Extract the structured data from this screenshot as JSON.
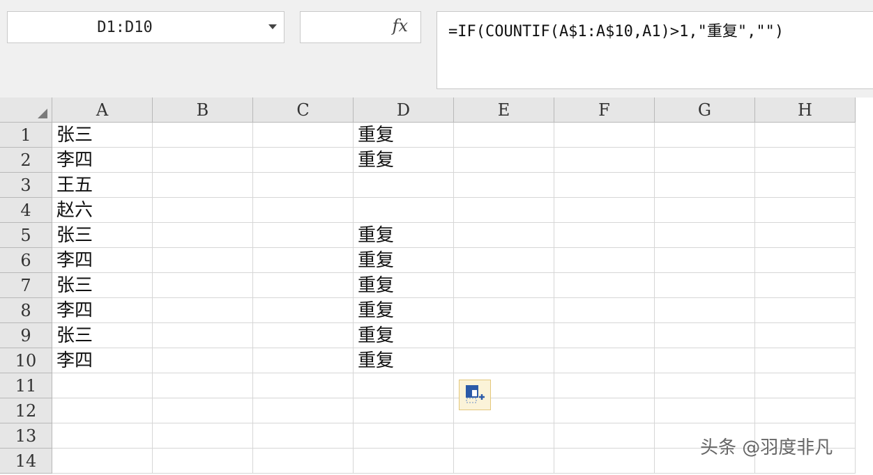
{
  "name_box": {
    "value": "D1:D10"
  },
  "formula_bar": {
    "fx_label": "fx",
    "formula": "=IF(COUNTIF(A$1:A$10,A1)>1,\"重复\",\"\")"
  },
  "columns": [
    "A",
    "B",
    "C",
    "D",
    "E",
    "F",
    "G",
    "H"
  ],
  "rows": [
    {
      "num": "1",
      "A": "张三",
      "D": "重复"
    },
    {
      "num": "2",
      "A": "李四",
      "D": "重复"
    },
    {
      "num": "3",
      "A": "王五",
      "D": ""
    },
    {
      "num": "4",
      "A": "赵六",
      "D": ""
    },
    {
      "num": "5",
      "A": "张三",
      "D": "重复"
    },
    {
      "num": "6",
      "A": "李四",
      "D": "重复"
    },
    {
      "num": "7",
      "A": "张三",
      "D": "重复"
    },
    {
      "num": "8",
      "A": "李四",
      "D": "重复"
    },
    {
      "num": "9",
      "A": "张三",
      "D": "重复"
    },
    {
      "num": "10",
      "A": "李四",
      "D": "重复"
    },
    {
      "num": "11",
      "A": "",
      "D": ""
    },
    {
      "num": "12",
      "A": "",
      "D": ""
    },
    {
      "num": "13",
      "A": "",
      "D": ""
    },
    {
      "num": "14",
      "A": "",
      "D": ""
    }
  ],
  "autofill_options": {
    "icon": "autofill-options-icon"
  },
  "watermark": "头条 @羽度非凡"
}
